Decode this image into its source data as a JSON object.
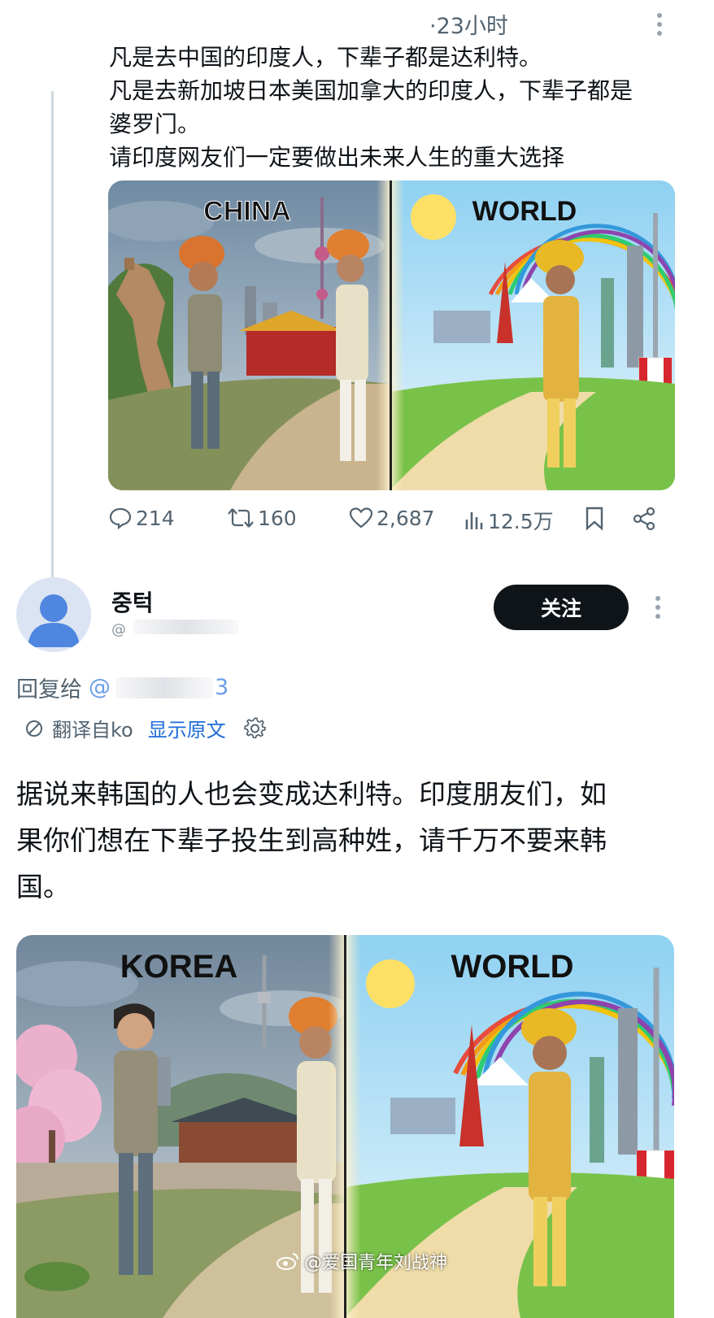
{
  "post": {
    "time": "·23小时",
    "lines": [
      "凡是去中国的印度人，下辈子都是达利特。",
      "凡是去新加坡日本美国加拿大的印度人，下辈子都是",
      "婆罗门。",
      "请印度网友们一定要做出未来人生的重大选择"
    ],
    "image": {
      "left_label": "CHINA",
      "right_label": "WORLD"
    },
    "stats": {
      "replies": "214",
      "reposts": "160",
      "likes": "2,687",
      "views": "12.5万"
    }
  },
  "reply": {
    "author_name": "중턱",
    "author_handle": "@",
    "follow_label": "关注",
    "reply_to_prefix": "回复给",
    "reply_to_handle_start": "@",
    "reply_to_handle_end": "3",
    "translated_from": "翻译自ko",
    "show_original": "显示原文",
    "lines": [
      "据说来韩国的人也会变成达利特。印度朋友们，如",
      "果你们想在下辈子投生到高种姓，请千万不要来韩",
      "国。"
    ],
    "image": {
      "left_label": "KOREA",
      "right_label": "WORLD"
    }
  },
  "watermark": "@爱国青年刘战神",
  "colors": {
    "text": "#0f1419",
    "muted": "#536471",
    "link": "#1d6bd8",
    "button": "#0f1419"
  }
}
